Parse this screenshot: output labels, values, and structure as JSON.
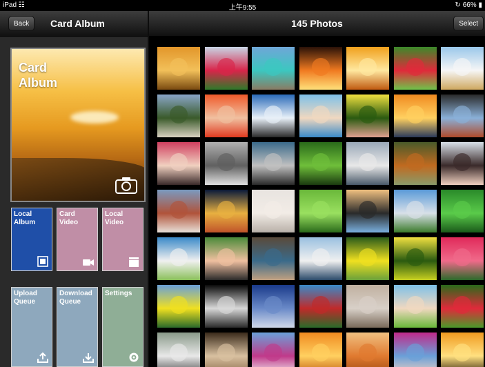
{
  "status": {
    "device": "iPad",
    "time": "上午9:55",
    "battery": "66%"
  },
  "leftNav": {
    "back_label": "Back",
    "title": "Card Album"
  },
  "rightNav": {
    "title": "145 Photos",
    "select_label": "Select"
  },
  "cover": {
    "line1": "Card",
    "line2": "Album"
  },
  "tiles": [
    {
      "line1": "Local",
      "line2": "Album",
      "color": "#1f4fa8",
      "icon": "album-icon"
    },
    {
      "line1": "Card",
      "line2": "Video",
      "color": "#c08ea6",
      "icon": "video-camera-icon"
    },
    {
      "line1": "Local",
      "line2": "Video",
      "color": "#c08ea6",
      "icon": "clapper-icon"
    },
    {
      "line1": "Upload",
      "line2": "Queue",
      "color": "#8ea8bd",
      "icon": "upload-icon"
    },
    {
      "line1": "Download",
      "line2": "Queue",
      "color": "#8ea8bd",
      "icon": "download-icon"
    },
    {
      "line1": "Settings",
      "line2": "",
      "color": "#8fae96",
      "icon": "settings-gear-icon"
    }
  ],
  "photos": [
    [
      "#e2962a",
      "#f2c05a",
      "#7a4a10"
    ],
    [
      "#c8d5e5",
      "#d8254a",
      "#2f7a2a"
    ],
    [
      "#6fa6d8",
      "#3cc7c0",
      "#8a7b63"
    ],
    [
      "#2a1208",
      "#f07a20",
      "#ffe07a"
    ],
    [
      "#f0a01c",
      "#ffe8a0",
      "#c05a10"
    ],
    [
      "#3a8a2a",
      "#e02a3a",
      "#6fc24a"
    ],
    [
      "#9ac7ea",
      "#f6f6f6",
      "#cfa860"
    ],
    [
      "#8aa6c8",
      "#3a5a2a",
      "#d8d0c0"
    ],
    [
      "#f05a2a",
      "#f0c0a0",
      "#e03a20"
    ],
    [
      "#2a6ab8",
      "#e8f0f8",
      "#2a2a2a"
    ],
    [
      "#7ec0e8",
      "#f0d8c0",
      "#3a8ac8"
    ],
    [
      "#f0e040",
      "#2a5a10",
      "#e0a090"
    ],
    [
      "#f08a20",
      "#ffd060",
      "#2a3a5a"
    ],
    [
      "#2a2a2a",
      "#8ab0d8",
      "#b04a2a"
    ],
    [
      "#d04060",
      "#f0d0c0",
      "#3a2a2a"
    ],
    [
      "#b0b0b0",
      "#606060",
      "#e0e0e0"
    ],
    [
      "#3a6a8a",
      "#c0c0c0",
      "#2a2a2a"
    ],
    [
      "#2a6a1a",
      "#6fbf3a",
      "#1a3a10"
    ],
    [
      "#9aa8b8",
      "#e8e8e8",
      "#4a5a6a"
    ],
    [
      "#4a5a2a",
      "#c06a20",
      "#8a9a6a"
    ],
    [
      "#d8e0e8",
      "#3a2a2a",
      "#f0d0c0"
    ],
    [
      "#7a9ac0",
      "#b0533a",
      "#e8e0d8"
    ],
    [
      "#0a1a3a",
      "#e8b040",
      "#c0542a"
    ],
    [
      "#e8e4e0",
      "#f2ece6",
      "#b8b0a8"
    ],
    [
      "#6ab83a",
      "#9ae060",
      "#2a6a1a"
    ],
    [
      "#f0c080",
      "#2a2a2a",
      "#7ab0e0"
    ],
    [
      "#5a9ad8",
      "#d8e0e8",
      "#3a7a2a"
    ],
    [
      "#2a8a2a",
      "#5acb4a",
      "#1a5a1a"
    ],
    [
      "#3a8ac8",
      "#f0f0f0",
      "#8ac05a"
    ],
    [
      "#4a8a3a",
      "#f0c0a0",
      "#2a2a2a"
    ],
    [
      "#5a4a3a",
      "#3a6a8a",
      "#c0a080"
    ],
    [
      "#9ac0e0",
      "#f0f0f0",
      "#2a4a6a"
    ],
    [
      "#2a5a1a",
      "#f0e020",
      "#6aa03a"
    ],
    [
      "#f0e040",
      "#2a5a10",
      "#c8d020"
    ],
    [
      "#e02a5a",
      "#f06a8a",
      "#2a6a2a"
    ],
    [
      "#6aa0d8",
      "#f0e020",
      "#2a6a2a"
    ],
    [
      "#0a0a0a",
      "#d8d8d8",
      "#2a2a2a"
    ],
    [
      "#1a3a8a",
      "#6a8ac8",
      "#d0d8e8"
    ],
    [
      "#3a8ac8",
      "#c02a2a",
      "#2a6a2a"
    ],
    [
      "#c0b0a0",
      "#d8d0c8",
      "#7a6a5a"
    ],
    [
      "#7ec0e8",
      "#f0d8c0",
      "#6ab83a"
    ],
    [
      "#2a6a1a",
      "#e02a3a",
      "#4a9a2a"
    ],
    [
      "#8a9a8a",
      "#e8e8e8",
      "#4a4a4a"
    ],
    [
      "#3a2a1a",
      "#d8c0a0",
      "#8a6a4a"
    ],
    [
      "#6aa0d8",
      "#c03a8a",
      "#f0f0f0"
    ],
    [
      "#f08a20",
      "#ffd060",
      "#c05a10"
    ],
    [
      "#f0c080",
      "#e07a30",
      "#a04a10"
    ],
    [
      "#c02a8a",
      "#6aa0d8",
      "#f0d0c0"
    ],
    [
      "#f09a20",
      "#ffe080",
      "#2a1a08"
    ]
  ]
}
